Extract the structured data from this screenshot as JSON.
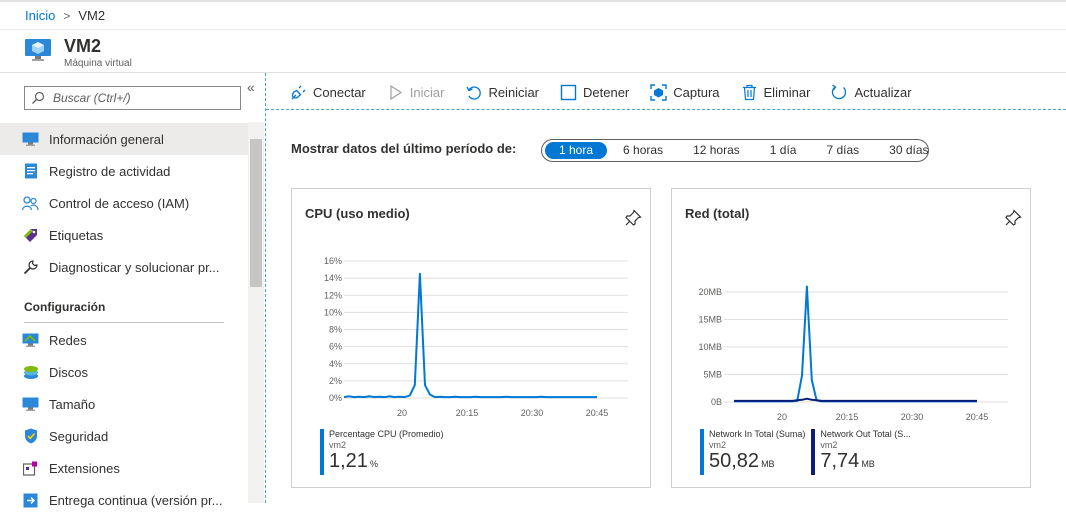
{
  "breadcrumb": {
    "home": "Inicio",
    "current": "VM2"
  },
  "header": {
    "title": "VM2",
    "subtitle": "Máquina virtual"
  },
  "sidebar": {
    "search_placeholder": "Buscar (Ctrl+/)",
    "collapse": "«",
    "items": [
      {
        "label": "Información general",
        "icon": "monitor-icon",
        "active": true
      },
      {
        "label": "Registro de actividad",
        "icon": "activity-log-icon"
      },
      {
        "label": "Control de acceso (IAM)",
        "icon": "people-icon"
      },
      {
        "label": "Etiquetas",
        "icon": "tag-icon"
      },
      {
        "label": "Diagnosticar y solucionar pr...",
        "icon": "wrench-icon"
      }
    ],
    "section_title": "Configuración",
    "config_items": [
      {
        "label": "Redes",
        "icon": "network-icon"
      },
      {
        "label": "Discos",
        "icon": "disks-icon"
      },
      {
        "label": "Tamaño",
        "icon": "size-icon"
      },
      {
        "label": "Seguridad",
        "icon": "shield-icon"
      },
      {
        "label": "Extensiones",
        "icon": "extensions-icon"
      },
      {
        "label": "Entrega continua (versión pr...",
        "icon": "delivery-icon"
      }
    ]
  },
  "toolbar": {
    "connect": "Conectar",
    "start": "Iniciar",
    "restart": "Reiniciar",
    "stop": "Detener",
    "capture": "Captura",
    "delete": "Eliminar",
    "refresh": "Actualizar"
  },
  "period": {
    "label": "Mostrar datos del último período de:",
    "options": [
      "1 hora",
      "6 horas",
      "12 horas",
      "1 día",
      "7 días",
      "30 días"
    ],
    "selected": "1 hora"
  },
  "colors": {
    "accent": "#0078d4",
    "dark_series": "#0a1d7a"
  },
  "chart_data": [
    {
      "type": "line",
      "title": "CPU (uso medio)",
      "x_ticks": [
        "20",
        "20:15",
        "20:30",
        "20:45"
      ],
      "y_ticks": [
        "0%",
        "2%",
        "4%",
        "6%",
        "8%",
        "10%",
        "12%",
        "14%",
        "16%"
      ],
      "ylim": [
        0,
        16
      ],
      "grid": true,
      "series": [
        {
          "name": "Percentage CPU (Promedio)",
          "sub": "vm2",
          "value": "1,21",
          "unit": "%",
          "color": "#0078d4",
          "x": [
            0,
            1,
            2,
            3,
            4,
            5,
            6,
            7,
            8,
            9,
            10,
            11,
            12,
            13,
            14,
            15,
            16,
            17,
            18,
            19,
            20,
            21,
            22,
            23,
            24,
            25,
            26,
            27,
            28,
            29,
            30,
            31,
            32,
            33,
            34,
            35,
            36,
            37,
            38,
            39,
            40,
            41,
            42,
            43,
            44,
            45,
            46,
            47,
            48,
            49,
            50
          ],
          "y": [
            0.1,
            0.2,
            0.1,
            0.15,
            0.1,
            0.2,
            0.1,
            0.15,
            0.1,
            0.2,
            0.1,
            0.15,
            0.1,
            0.3,
            1.5,
            14.5,
            1.5,
            0.4,
            0.1,
            0.15,
            0.1,
            0.1,
            0.15,
            0.1,
            0.1,
            0.1,
            0.15,
            0.1,
            0.1,
            0.1,
            0.1,
            0.1,
            0.15,
            0.1,
            0.1,
            0.1,
            0.1,
            0.1,
            0.1,
            0.15,
            0.1,
            0.1,
            0.1,
            0.1,
            0.1,
            0.1,
            0.1,
            0.1,
            0.1,
            0.1,
            0.1
          ]
        }
      ]
    },
    {
      "type": "line",
      "title": "Red (total)",
      "x_ticks": [
        "20",
        "20:15",
        "20:30",
        "20:45"
      ],
      "y_ticks": [
        "0B",
        "5MB",
        "10MB",
        "15MB",
        "20MB"
      ],
      "ylim": [
        0,
        22
      ],
      "grid": true,
      "series": [
        {
          "name": "Network In Total (Suma)",
          "sub": "vm2",
          "value": "50,82",
          "unit": "MB",
          "color": "#0078d4",
          "x": [
            0,
            1,
            2,
            3,
            4,
            5,
            6,
            7,
            8,
            9,
            10,
            11,
            12,
            13,
            14,
            15,
            16,
            17,
            18,
            19,
            20,
            21,
            22,
            23,
            24,
            25,
            26,
            27,
            28,
            29,
            30,
            31,
            32,
            33,
            34,
            35,
            36,
            37,
            38,
            39,
            40,
            41,
            42,
            43,
            44,
            45,
            46,
            47,
            48,
            49,
            50
          ],
          "y": [
            0.1,
            0.1,
            0.1,
            0.1,
            0.1,
            0.1,
            0.1,
            0.1,
            0.1,
            0.1,
            0.1,
            0.1,
            0.1,
            0.2,
            4.8,
            21.0,
            4.0,
            0.3,
            0.1,
            0.1,
            0.1,
            0.1,
            0.1,
            0.1,
            0.1,
            0.1,
            0.1,
            0.1,
            0.1,
            0.1,
            0.1,
            0.1,
            0.1,
            0.1,
            0.1,
            0.1,
            0.1,
            0.1,
            0.1,
            0.1,
            0.1,
            0.1,
            0.1,
            0.1,
            0.1,
            0.1,
            0.1,
            0.1,
            0.1,
            0.1,
            0.1
          ]
        },
        {
          "name": "Network Out Total (S...",
          "sub": "vm2",
          "value": "7,74",
          "unit": "MB",
          "color": "#0a1d7a",
          "x": [
            0,
            1,
            2,
            3,
            4,
            5,
            6,
            7,
            8,
            9,
            10,
            11,
            12,
            13,
            14,
            15,
            16,
            17,
            18,
            19,
            20,
            21,
            22,
            23,
            24,
            25,
            26,
            27,
            28,
            29,
            30,
            31,
            32,
            33,
            34,
            35,
            36,
            37,
            38,
            39,
            40,
            41,
            42,
            43,
            44,
            45,
            46,
            47,
            48,
            49,
            50
          ],
          "y": [
            0.2,
            0.2,
            0.2,
            0.2,
            0.2,
            0.2,
            0.2,
            0.2,
            0.2,
            0.2,
            0.2,
            0.2,
            0.2,
            0.3,
            0.4,
            0.6,
            0.4,
            0.3,
            0.2,
            0.2,
            0.2,
            0.2,
            0.2,
            0.2,
            0.2,
            0.2,
            0.2,
            0.2,
            0.2,
            0.2,
            0.2,
            0.2,
            0.2,
            0.2,
            0.2,
            0.2,
            0.2,
            0.2,
            0.2,
            0.2,
            0.2,
            0.2,
            0.2,
            0.2,
            0.2,
            0.2,
            0.2,
            0.2,
            0.2,
            0.2,
            0.2
          ]
        }
      ]
    }
  ]
}
